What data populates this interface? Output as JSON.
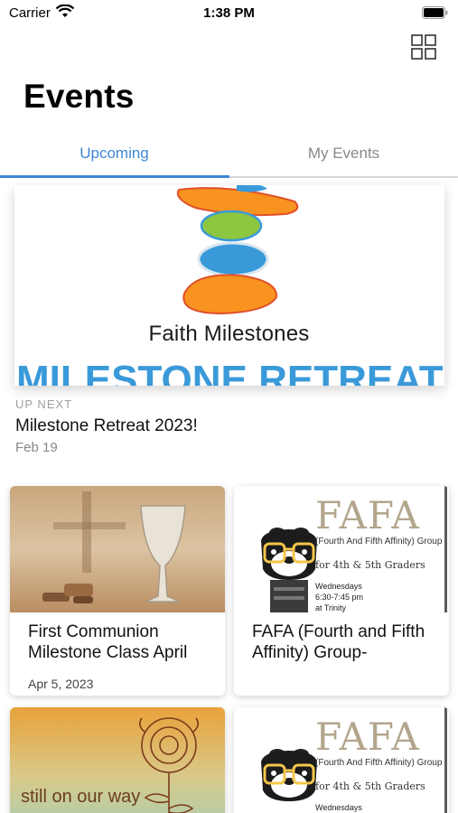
{
  "status": {
    "carrier": "Carrier",
    "time": "1:38 PM"
  },
  "header": {
    "title": "Events",
    "grid_icon": "grid-icon"
  },
  "tabs": [
    {
      "label": "Upcoming",
      "active": true
    },
    {
      "label": "My Events",
      "active": false
    }
  ],
  "featured": {
    "banner_brand": "Faith Milestones",
    "banner_text": "MILESTONE RETREAT",
    "up_next_label": "UP NEXT",
    "title": "Milestone Retreat 2023!",
    "date": "Feb 19"
  },
  "cards": [
    {
      "title": "First Communion Milestone Class April",
      "date": "Apr 5, 2023"
    },
    {
      "title": "FAFA (Fourth and Fifth Affinity) Group-",
      "date": "",
      "image_heading": "FAFA",
      "image_sub": "(Fourth And Fifth Affinity) Group",
      "image_grades": "for 4th & 5th Graders",
      "image_sched": [
        "Wednesdays",
        "6:30-7:45 pm",
        "at Trinity"
      ]
    },
    {
      "title": "",
      "date": "",
      "image_text": "still on our way"
    },
    {
      "title": "",
      "date": "",
      "image_heading": "FAFA",
      "image_sub": "(Fourth And Fifth Affinity) Group",
      "image_grades": "for 4th & 5th Graders",
      "image_sched": [
        "Wednesdays"
      ]
    }
  ],
  "colors": {
    "accent": "#3f86d6",
    "fafa": "#b3a58c"
  }
}
